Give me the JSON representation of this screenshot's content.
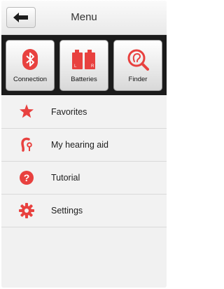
{
  "header": {
    "title": "Menu",
    "back_icon": "left-arrow-icon"
  },
  "tiles": [
    {
      "label": "Connection",
      "icon": "bluetooth-icon"
    },
    {
      "label": "Batteries",
      "icon": "battery-icon",
      "left_tag": "L",
      "right_tag": "R"
    },
    {
      "label": "Finder",
      "icon": "ear-search-icon"
    }
  ],
  "menu": [
    {
      "label": "Favorites",
      "icon": "star-icon"
    },
    {
      "label": "My hearing aid",
      "icon": "hearing-aid-icon"
    },
    {
      "label": "Tutorial",
      "icon": "question-icon"
    },
    {
      "label": "Settings",
      "icon": "gear-icon"
    }
  ],
  "colors": {
    "accent": "#e8413f",
    "tile_bar": "#1b1b1b",
    "background": "#f1f1f1"
  }
}
